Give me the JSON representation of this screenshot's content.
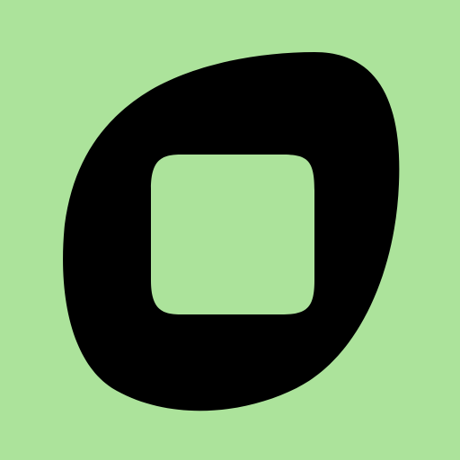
{
  "icon": {
    "name": "rounded-square-in-blob-icon",
    "background_color": "#ace39b",
    "shape_color": "#000000",
    "inner_color": "#ace39b"
  }
}
